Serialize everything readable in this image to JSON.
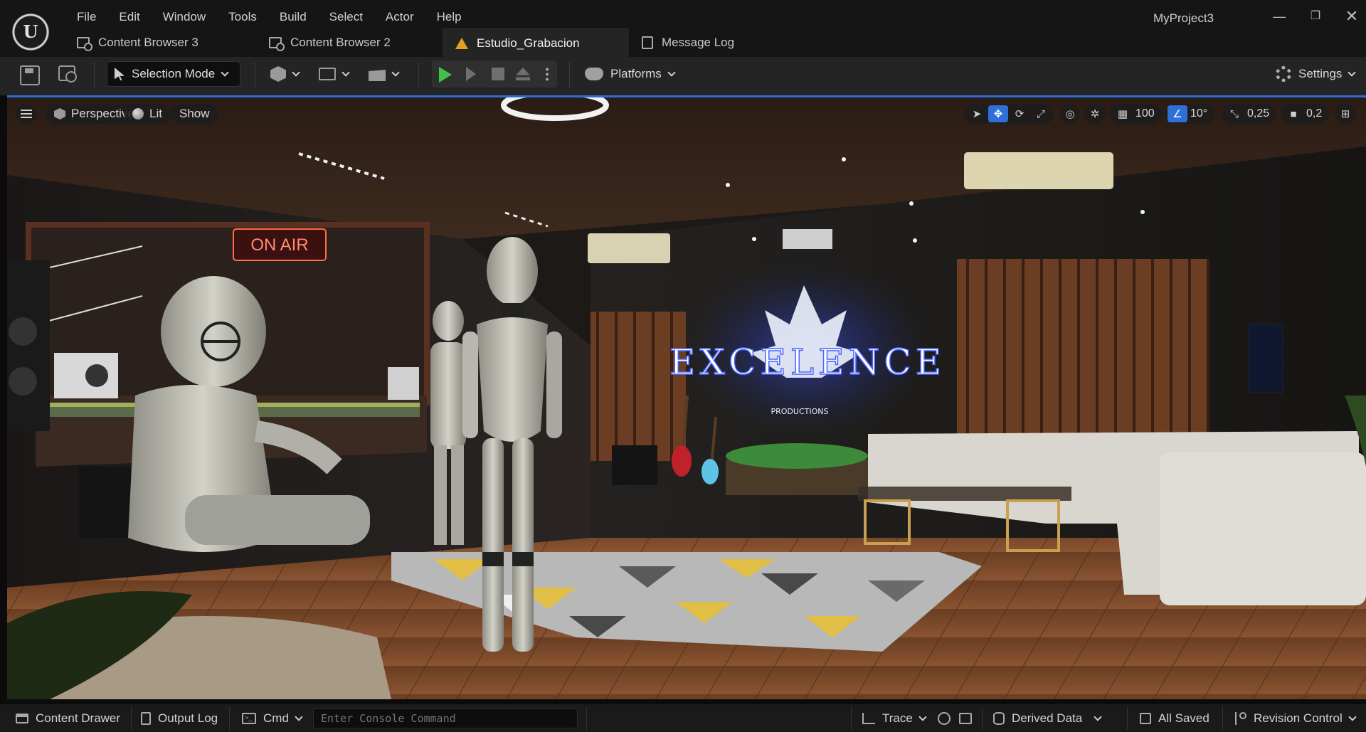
{
  "app": {
    "project_title": "MyProject3",
    "logo_letter": "U"
  },
  "menu": [
    "File",
    "Edit",
    "Window",
    "Tools",
    "Build",
    "Select",
    "Actor",
    "Help"
  ],
  "tabs": [
    {
      "label": "Content Browser 3",
      "icon": "content-browser-icon",
      "active": false
    },
    {
      "label": "Content Browser 2",
      "icon": "content-browser-icon",
      "active": false
    },
    {
      "label": "Estudio_Grabacion",
      "icon": "level-icon",
      "active": true
    },
    {
      "label": "Message Log",
      "icon": "message-log-icon",
      "active": false
    }
  ],
  "toolbar": {
    "mode_label": "Selection Mode",
    "platforms_label": "Platforms",
    "settings_label": "Settings"
  },
  "viewport": {
    "perspective_label": "Perspective",
    "lit_label": "Lit",
    "show_label": "Show",
    "grid_snap": "100",
    "rotation_snap": "10°",
    "scale_snap": "0,25",
    "camera_speed": "0,2",
    "scene_text": {
      "on_air": "ON AIR",
      "logo": "EXCELENCE",
      "logo_sub": "PRODUCTIONS"
    }
  },
  "statusbar": {
    "content_drawer": "Content Drawer",
    "output_log": "Output Log",
    "cmd": "Cmd",
    "console_placeholder": "Enter Console Command",
    "trace": "Trace",
    "derived_data": "Derived Data",
    "all_saved": "All Saved",
    "revision_control": "Revision Control"
  },
  "colors": {
    "accent": "#2f6fd8",
    "play_green": "#3fc24a",
    "level_icon": "#e3a020"
  }
}
